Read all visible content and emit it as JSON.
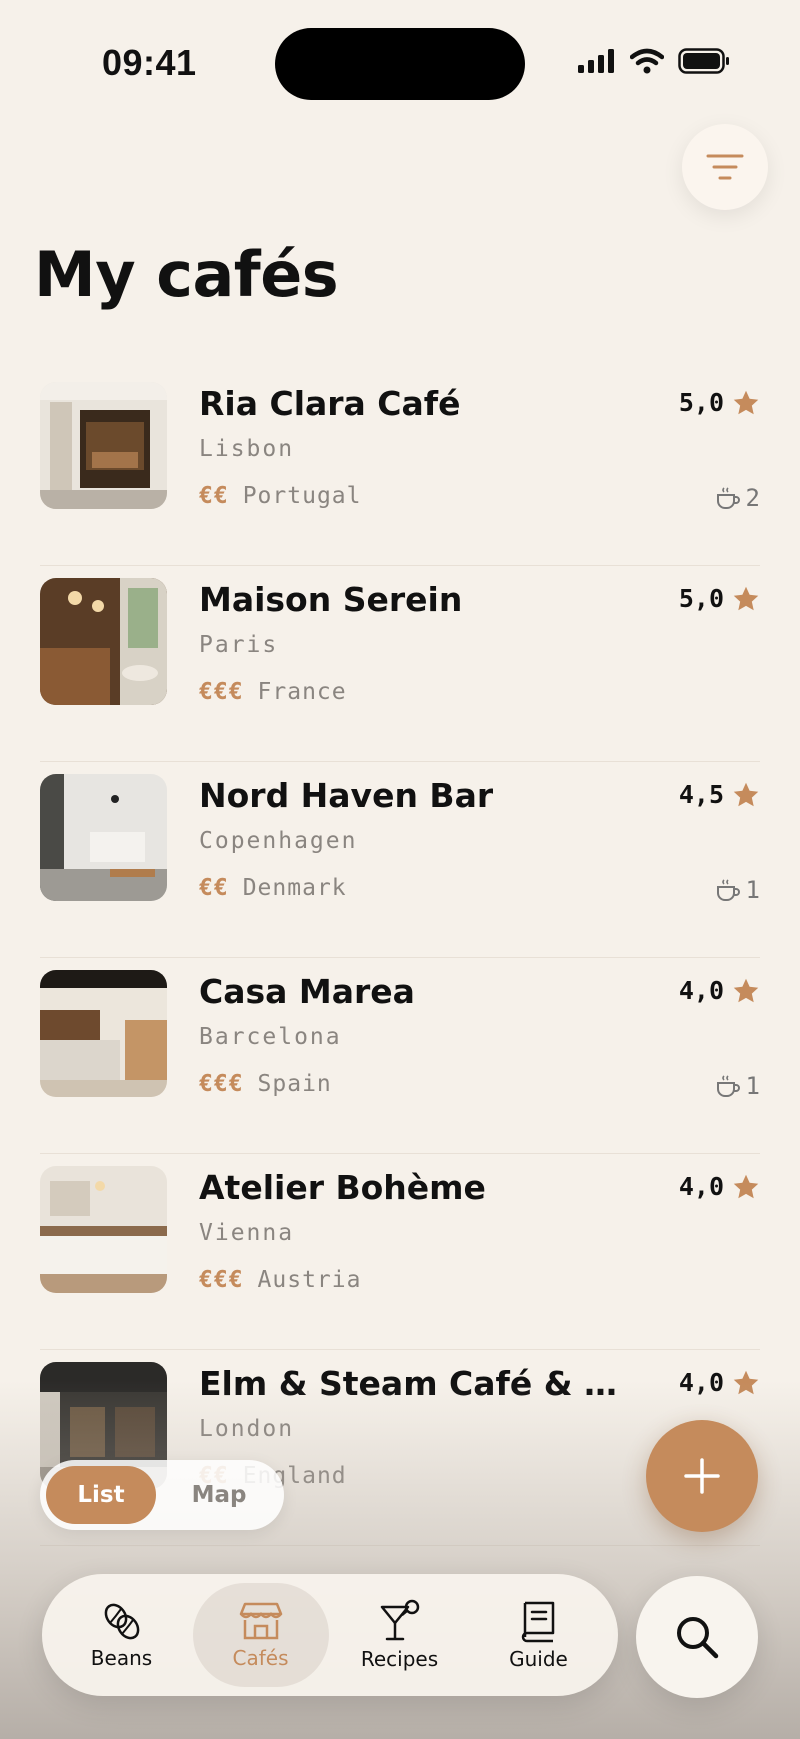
{
  "status_bar": {
    "time": "09:41"
  },
  "header": {
    "title": "My cafés",
    "filter_icon": "filter-lines-icon"
  },
  "colors": {
    "accent": "#c58b5c",
    "background": "#f6f1ea",
    "text": "#111111",
    "muted": "#8a8580"
  },
  "cafes": [
    {
      "name": "Ria Clara Café",
      "city": "Lisbon",
      "price": "€€",
      "country": "Portugal",
      "rating": "5,0",
      "cups": "2"
    },
    {
      "name": "Maison Serein",
      "city": "Paris",
      "price": "€€€",
      "country": "France",
      "rating": "5,0",
      "cups": ""
    },
    {
      "name": "Nord Haven Bar",
      "city": "Copenhagen",
      "price": "€€",
      "country": "Denmark",
      "rating": "4,5",
      "cups": "1"
    },
    {
      "name": "Casa Marea",
      "city": "Barcelona",
      "price": "€€€",
      "country": "Spain",
      "rating": "4,0",
      "cups": "1"
    },
    {
      "name": "Atelier Bohème",
      "city": "Vienna",
      "price": "€€€",
      "country": "Austria",
      "rating": "4,0",
      "cups": ""
    },
    {
      "name": "Elm & Steam Café & Bake…",
      "city": "London",
      "price": "€€",
      "country": "England",
      "rating": "4,0",
      "cups": ""
    }
  ],
  "view_toggle": {
    "list_label": "List",
    "map_label": "Map",
    "selected": "List"
  },
  "tabs": [
    {
      "label": "Beans",
      "icon": "beans-icon"
    },
    {
      "label": "Cafés",
      "icon": "cafe-storefront-icon"
    },
    {
      "label": "Recipes",
      "icon": "cocktail-glass-icon"
    },
    {
      "label": "Guide",
      "icon": "book-icon"
    }
  ],
  "active_tab": "Cafés",
  "actions": {
    "add_icon": "plus-icon",
    "search_icon": "search-icon"
  }
}
